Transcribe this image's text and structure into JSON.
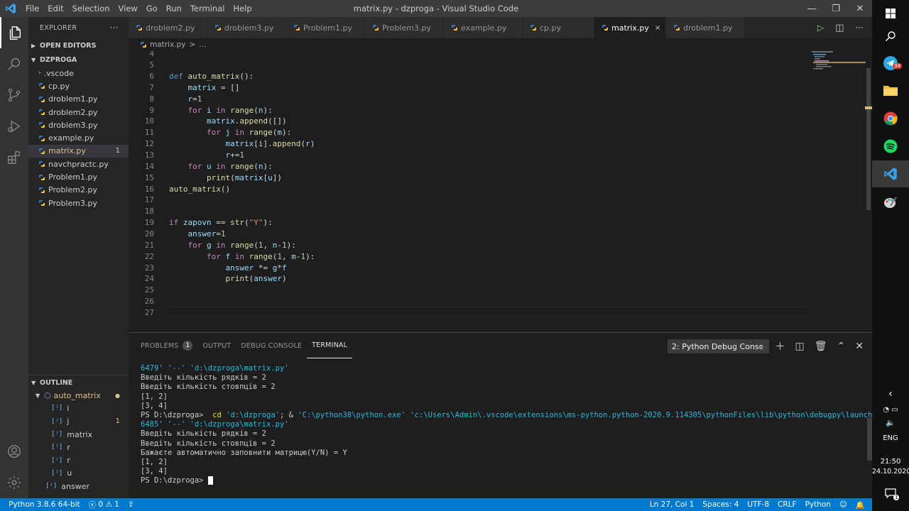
{
  "window": {
    "title": "matrix.py - dzproga - Visual Studio Code",
    "menu": [
      "File",
      "Edit",
      "Selection",
      "View",
      "Go",
      "Run",
      "Terminal",
      "Help"
    ]
  },
  "sidebar": {
    "explorer_label": "EXPLORER",
    "more": "···",
    "open_editors": "OPEN EDITORS",
    "folder": "DZPROGA",
    "files": [
      {
        "name": ".vscode",
        "folder": true
      },
      {
        "name": "cp.py"
      },
      {
        "name": "droblem1.py"
      },
      {
        "name": "droblem2.py"
      },
      {
        "name": "droblem3.py"
      },
      {
        "name": "example.py"
      },
      {
        "name": "matrix.py",
        "active": true,
        "badge": "1"
      },
      {
        "name": "navchpractc.py"
      },
      {
        "name": "Problem1.py"
      },
      {
        "name": "Problem2.py"
      },
      {
        "name": "Problem3.py"
      }
    ],
    "outline_label": "OUTLINE",
    "outline_root": "auto_matrix",
    "outline_items": [
      {
        "name": "i"
      },
      {
        "name": "j",
        "badge": "1"
      },
      {
        "name": "matrix"
      },
      {
        "name": "r"
      },
      {
        "name": "r"
      },
      {
        "name": "u"
      }
    ],
    "outline_extra": "answer"
  },
  "tabs": [
    {
      "name": "droblem2.py"
    },
    {
      "name": "droblem3.py"
    },
    {
      "name": "Problem1.py"
    },
    {
      "name": "Problem3.py"
    },
    {
      "name": "example.py"
    },
    {
      "name": "cp.py"
    },
    {
      "name": "matrix.py",
      "active": true,
      "close": "×"
    },
    {
      "name": "droblem1.py"
    }
  ],
  "breadcrumb": {
    "file": "matrix.py",
    "sep": ">",
    "rest": "..."
  },
  "editor": {
    "lines": [
      {
        "n": "4",
        "html": ""
      },
      {
        "n": "5",
        "html": ""
      },
      {
        "n": "6",
        "html": "<span class='kw'>def</span> <span class='fn'>auto_matrix</span>():"
      },
      {
        "n": "7",
        "html": "    <span class='var'>matrix</span> = []"
      },
      {
        "n": "8",
        "html": "    <span class='var'>r</span>=<span class='num'>1</span>"
      },
      {
        "n": "9",
        "html": "    <span class='kw2'>for</span> <span class='var'>i</span> <span class='kw2'>in</span> <span class='fn'>range</span>(<span class='var'>n</span>):"
      },
      {
        "n": "10",
        "html": "        <span class='var'>matrix</span>.<span class='fn'>append</span>([])"
      },
      {
        "n": "11",
        "html": "        <span class='kw2'>for</span> <span class='var'>j</span> <span class='kw2'>in</span> <span class='fn'>range</span>(<span class='var'>m</span>):"
      },
      {
        "n": "12",
        "html": "            <span class='var'>matrix</span>[<span class='var'>i</span>].<span class='fn'>append</span>(<span class='var'>r</span>)"
      },
      {
        "n": "13",
        "html": "            <span class='var'>r</span>+=<span class='num'>1</span>"
      },
      {
        "n": "14",
        "html": "    <span class='kw2'>for</span> <span class='var'>u</span> <span class='kw2'>in</span> <span class='fn'>range</span>(<span class='var'>n</span>):"
      },
      {
        "n": "15",
        "html": "        <span class='fn'>print</span>(<span class='var'>matrix</span>[<span class='var'>u</span>])"
      },
      {
        "n": "16",
        "html": "<span class='fn'>auto_matrix</span>()"
      },
      {
        "n": "17",
        "html": ""
      },
      {
        "n": "18",
        "html": ""
      },
      {
        "n": "19",
        "html": "<span class='kw2'>if</span> <span class='var'>zapovn</span> == <span class='fn'>str</span>(<span class='str'>\"Y\"</span>):"
      },
      {
        "n": "20",
        "html": "    <span class='var'>answer</span>=<span class='num'>1</span>"
      },
      {
        "n": "21",
        "html": "    <span class='kw2'>for</span> <span class='var'>g</span> <span class='kw2'>in</span> <span class='fn'>range</span>(<span class='num'>1</span>, <span class='var'>n</span>-<span class='num'>1</span>):"
      },
      {
        "n": "22",
        "html": "        <span class='kw2'>for</span> <span class='var'>f</span> <span class='kw2'>in</span> <span class='fn'>range</span>(<span class='num'>1</span>, <span class='var'>m</span>-<span class='num'>1</span>):"
      },
      {
        "n": "23",
        "html": "            <span class='var'>answer</span> *= <span class='var'>g</span>*<span class='var'>f</span>"
      },
      {
        "n": "24",
        "html": "            <span class='fn'>print</span>(<span class='var'>answer</span>)"
      },
      {
        "n": "25",
        "html": ""
      },
      {
        "n": "26",
        "html": ""
      },
      {
        "n": "27",
        "html": ""
      }
    ]
  },
  "panel": {
    "tabs": [
      "PROBLEMS",
      "OUTPUT",
      "DEBUG CONSOLE",
      "TERMINAL"
    ],
    "problems_count": "1",
    "terminal_select": "2: Python Debug Consc",
    "terminal_lines": [
      {
        "cls": "tcyan",
        "text": "6479' '--' 'd:\\dzproga\\matrix.py'"
      },
      {
        "cls": "",
        "text": "Введіть кількість рядків = 2"
      },
      {
        "cls": "",
        "text": "Введіть кількість стовпців = 2"
      },
      {
        "cls": "",
        "text": "[1, 2]"
      },
      {
        "cls": "",
        "text": "[3, 4]"
      },
      {
        "cls": "mix",
        "text": ""
      },
      {
        "cls": "tcyan",
        "text": "6485' '--' 'd:\\dzproga\\matrix.py'"
      },
      {
        "cls": "",
        "text": "Введіть кількість рядків = 2"
      },
      {
        "cls": "",
        "text": "Введіть кількість стовпців = 2"
      },
      {
        "cls": "",
        "text": "Бажаєте автоматично заповнити матрицю(Y/N) = Y"
      },
      {
        "cls": "",
        "text": "[1, 2]"
      },
      {
        "cls": "",
        "text": "[3, 4]"
      },
      {
        "cls": "prompt",
        "text": "PS D:\\dzproga> "
      }
    ],
    "cmd_prompt": "PS D:\\dzproga>",
    "cmd_cd": "cd",
    "cmd_path": "'d:\\dzproga'",
    "cmd_amp": "; &",
    "cmd_rest": "'C:\\python38\\python.exe' 'c:\\Users\\Admin\\.vscode\\extensions\\ms-python.python-2020.9.114305\\pythonFiles\\lib\\python\\debugpy\\launcher' '5"
  },
  "status": {
    "python": "Python 3.8.6 64-bit",
    "errors": "0",
    "warnings": "1",
    "position": "Ln 27, Col 1",
    "spaces": "Spaces: 4",
    "encoding": "UTF-8",
    "eol": "CRLF",
    "language": "Python"
  },
  "taskbar": {
    "lang": "ENG",
    "time": "21:50",
    "date": "24.10.2020",
    "telegram_badge": "34",
    "notif_badge": "1"
  }
}
